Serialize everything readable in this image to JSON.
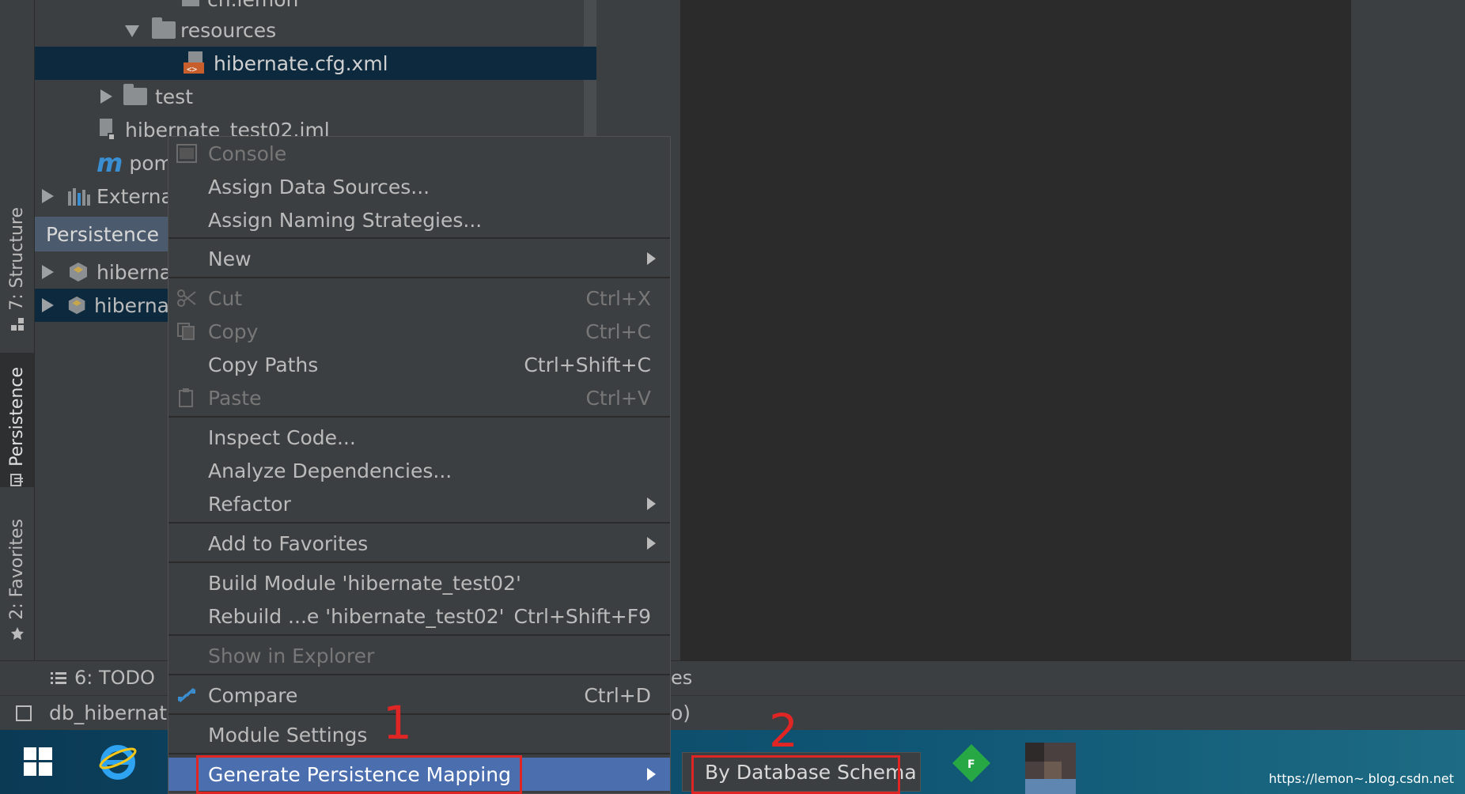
{
  "side_tabs": {
    "structure": "7: Structure",
    "persistence": "Persistence",
    "favorites": "2: Favorites"
  },
  "project_tree": {
    "partial_top": "cn.lemon",
    "resources": "resources",
    "hibernate_cfg": "hibernate.cfg.xml",
    "test": "test",
    "iml": "hibernate_test02.iml",
    "pom": "pom",
    "external": "External"
  },
  "persistence_panel": {
    "header": "Persistence",
    "items": [
      "hiberna",
      "hiberna"
    ]
  },
  "context_menu": {
    "console": "Console",
    "assign_data_sources": "Assign Data Sources...",
    "assign_naming": "Assign Naming Strategies...",
    "new": "New",
    "cut": "Cut",
    "cut_shortcut": "Ctrl+X",
    "copy": "Copy",
    "copy_shortcut": "Ctrl+C",
    "copy_paths": "Copy Paths",
    "copy_paths_shortcut": "Ctrl+Shift+C",
    "paste": "Paste",
    "paste_shortcut": "Ctrl+V",
    "inspect_code": "Inspect Code...",
    "analyze_deps": "Analyze Dependencies...",
    "refactor": "Refactor",
    "add_favorites": "Add to Favorites",
    "build_module": "Build Module 'hibernate_test02'",
    "rebuild": "Rebuild ...e 'hibernate_test02'",
    "rebuild_shortcut": "Ctrl+Shift+F9",
    "show_explorer": "Show in Explorer",
    "compare": "Compare",
    "compare_shortcut": "Ctrl+D",
    "module_settings": "Module Settings",
    "generate_mapping": "Generate Persistence Mapping"
  },
  "submenu": {
    "by_db_schema": "By Database Schema"
  },
  "bottom": {
    "todo": "6: TODO",
    "partial_es": "es",
    "db_label": "db_hibernate",
    "partial_paren": "o)"
  },
  "annotations": {
    "one": "1",
    "two": "2"
  },
  "watermark": "https://lemon~.blog.csdn.net",
  "colors": {
    "highlight": "#4b6eaf",
    "annotation": "#e02525",
    "selected_row": "#0d293e"
  }
}
